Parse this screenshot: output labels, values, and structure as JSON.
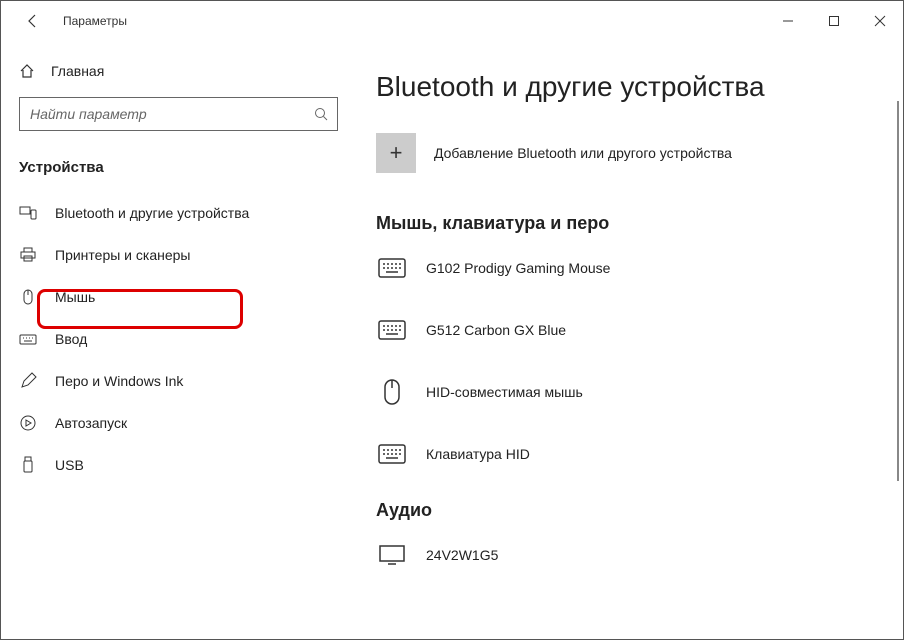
{
  "titlebar": {
    "title": "Параметры"
  },
  "sidebar": {
    "home_label": "Главная",
    "search_placeholder": "Найти параметр",
    "header": "Устройства",
    "items": [
      {
        "label": "Bluetooth и другие устройства"
      },
      {
        "label": "Принтеры и сканеры"
      },
      {
        "label": "Мышь"
      },
      {
        "label": "Ввод"
      },
      {
        "label": "Перо и Windows Ink"
      },
      {
        "label": "Автозапуск"
      },
      {
        "label": "USB"
      }
    ]
  },
  "content": {
    "page_title": "Bluetooth и другие устройства",
    "add_device_label": "Добавление Bluetooth или другого устройства",
    "section_peripherals": "Мышь, клавиатура и перо",
    "devices": [
      {
        "name": "G102 Prodigy Gaming Mouse",
        "icon": "keyboard"
      },
      {
        "name": "G512 Carbon GX Blue",
        "icon": "keyboard"
      },
      {
        "name": "HID-совместимая мышь",
        "icon": "mouse"
      },
      {
        "name": "Клавиатура HID",
        "icon": "keyboard"
      }
    ],
    "section_audio": "Аудио",
    "audio_devices": [
      {
        "name": "24V2W1G5",
        "icon": "monitor"
      }
    ]
  }
}
